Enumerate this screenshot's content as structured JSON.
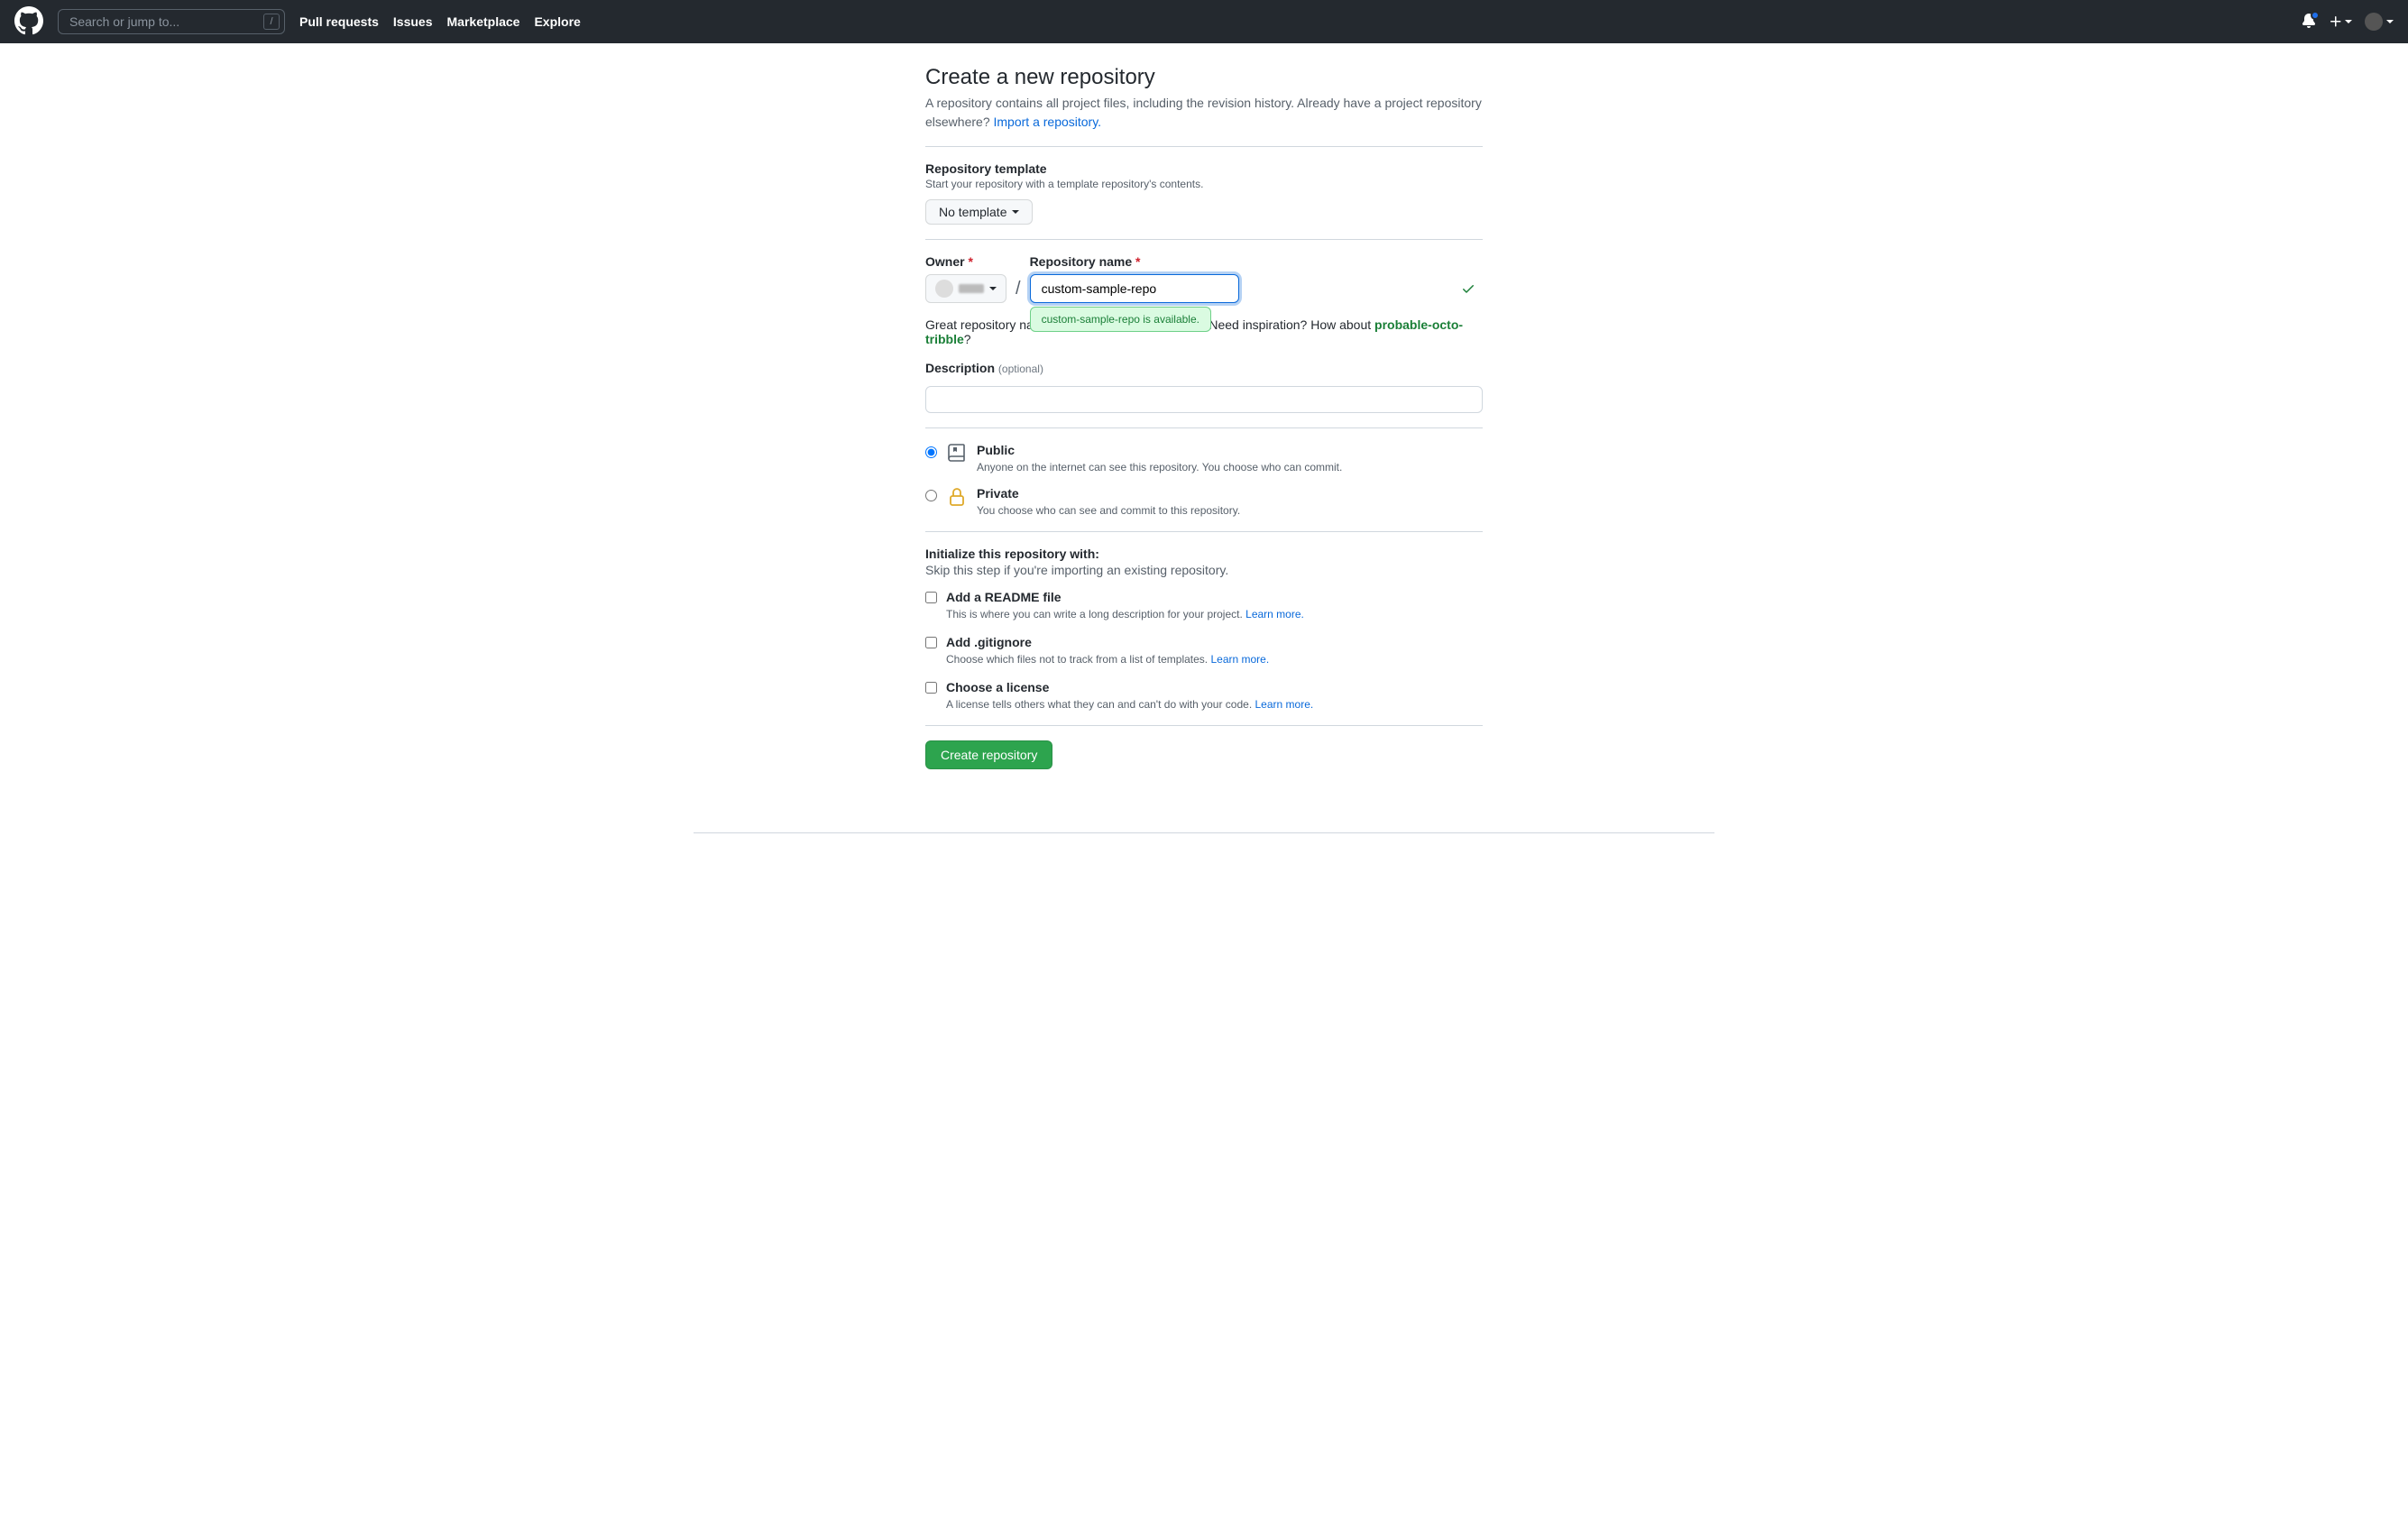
{
  "header": {
    "search_placeholder": "Search or jump to...",
    "nav": {
      "pull_requests": "Pull requests",
      "issues": "Issues",
      "marketplace": "Marketplace",
      "explore": "Explore"
    }
  },
  "page": {
    "title": "Create a new repository",
    "subtitle_prefix": "A repository contains all project files, including the revision history. Already have a project repository elsewhere? ",
    "import_link": "Import a repository."
  },
  "template": {
    "label": "Repository template",
    "hint": "Start your repository with a template repository's contents.",
    "button": "No template"
  },
  "owner_repo": {
    "owner_label": "Owner",
    "repo_label": "Repository name",
    "repo_value": "custom-sample-repo",
    "availability": "custom-sample-repo is available.",
    "suggest_prefix": "Great repository names are short and memorable. Need inspiration? How about ",
    "suggest_name": "probable-octo-tribble",
    "suggest_q": "?"
  },
  "description": {
    "label": "Description",
    "optional": "(optional)"
  },
  "visibility": {
    "public": {
      "label": "Public",
      "hint": "Anyone on the internet can see this repository. You choose who can commit."
    },
    "private": {
      "label": "Private",
      "hint": "You choose who can see and commit to this repository."
    }
  },
  "initialize": {
    "heading": "Initialize this repository with:",
    "skip_hint": "Skip this step if you're importing an existing repository.",
    "readme": {
      "label": "Add a README file",
      "hint_prefix": "This is where you can write a long description for your project. ",
      "learn_more": "Learn more."
    },
    "gitignore": {
      "label": "Add .gitignore",
      "hint_prefix": "Choose which files not to track from a list of templates. ",
      "learn_more": "Learn more."
    },
    "license": {
      "label": "Choose a license",
      "hint_prefix": "A license tells others what they can and can't do with your code. ",
      "learn_more": "Learn more."
    }
  },
  "submit": {
    "button": "Create repository"
  }
}
